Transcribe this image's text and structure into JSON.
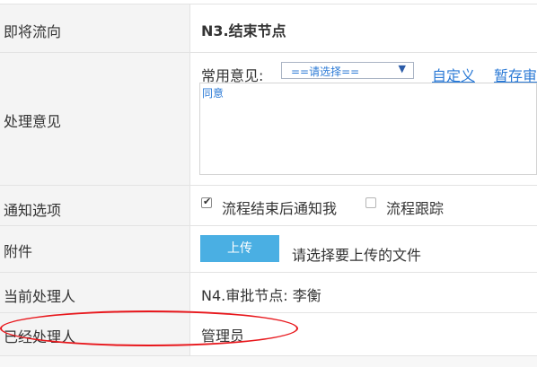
{
  "rows": {
    "next_flow": {
      "label": "即将流向",
      "value": "N3.结束节点"
    },
    "opinion": {
      "label": "处理意见",
      "common_label": "常用意见:",
      "select_value": "==请选择==",
      "custom_link": "自定义",
      "save_link": "暂存审",
      "text": "同意"
    },
    "notify": {
      "label": "通知选项",
      "option1": "流程结束后通知我",
      "option1_checked": true,
      "option2": "流程跟踪",
      "option2_checked": false
    },
    "attachment": {
      "label": "附件",
      "button": "上传",
      "hint": "请选择要上传的文件"
    },
    "current_handler": {
      "label": "当前处理人",
      "value": "N4.审批节点: 李衡"
    },
    "handled": {
      "label": "已经处理人",
      "value": "管理员"
    }
  },
  "colors": {
    "accent": "#4aafe3",
    "link": "#2b7ad6",
    "annotation": "#e8171c"
  }
}
